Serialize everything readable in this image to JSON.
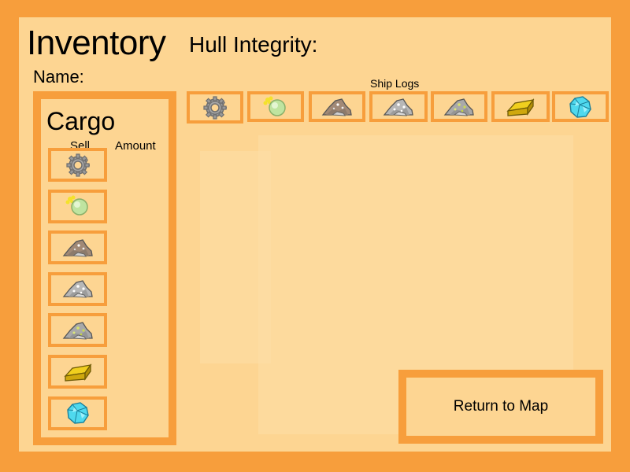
{
  "header": {
    "title": "Inventory",
    "hull_label": "Hull Integrity:",
    "name_label": "Name:"
  },
  "cargo": {
    "title": "Cargo",
    "sell_header": "Sell",
    "amount_header": "Amount",
    "items": [
      {
        "icon": "gear-icon"
      },
      {
        "icon": "glowing-orb-icon"
      },
      {
        "icon": "brown-ore-icon"
      },
      {
        "icon": "silver-ore-icon"
      },
      {
        "icon": "green-ore-icon"
      },
      {
        "icon": "gold-bar-icon"
      },
      {
        "icon": "cyan-crystal-icon"
      }
    ]
  },
  "ship_logs": {
    "label": "Ship Logs",
    "items": [
      {
        "icon": "gear-icon"
      },
      {
        "icon": "glowing-orb-icon"
      },
      {
        "icon": "brown-ore-icon"
      },
      {
        "icon": "silver-ore-icon"
      },
      {
        "icon": "green-ore-icon"
      },
      {
        "icon": "gold-bar-icon"
      },
      {
        "icon": "cyan-crystal-icon"
      }
    ]
  },
  "actions": {
    "return_label": "Return to Map"
  },
  "colors": {
    "frame": "#F79E3C",
    "panel": "#FDD592"
  }
}
